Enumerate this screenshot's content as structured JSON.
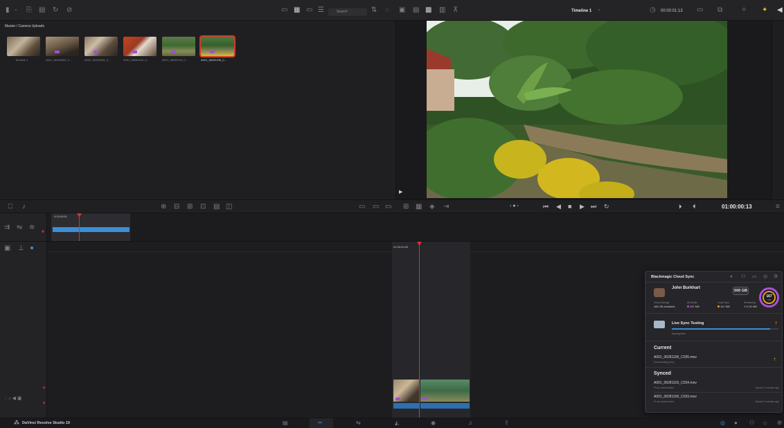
{
  "toolbar": {
    "search_placeholder": "Search",
    "timeline_name": "Timeline 1",
    "timecode": "00:00:01:13"
  },
  "media_pool": {
    "path": "Master / Camera Uploads",
    "clips": [
      {
        "name": "Timeline 1"
      },
      {
        "name": "A001_06100902_C..."
      },
      {
        "name": "A001_06100943_C..."
      },
      {
        "name": "A001_06281100_C..."
      },
      {
        "name": "A001_06281103_C..."
      },
      {
        "name": "A001_06281106_C..."
      }
    ]
  },
  "viewer": {
    "timecode": "01:00:00:13"
  },
  "timeline": {
    "range_start": "01:00:00:00",
    "mini_start": "01:00:00:00"
  },
  "cloud_sync": {
    "title": "Blackmagic Cloud Sync",
    "user": "John Burkhart",
    "plan": "500 GB",
    "ring_value": "167",
    "ring_unit": "MB",
    "stats": [
      {
        "label": "Cloud Storage",
        "value": "486 GB Available"
      },
      {
        "label": "All Media",
        "value": "167 MB"
      },
      {
        "label": "Local Sync",
        "value": "167 MB"
      },
      {
        "label": "Remaining",
        "value": "0.00 MB"
      }
    ],
    "project": {
      "name": "Live Sync Testing",
      "status": "Syncing files",
      "progress": 0.92
    },
    "current_heading": "Current",
    "current_files": [
      {
        "name": "A001_06281106_C035.mov",
        "status": "Downloading proxy"
      }
    ],
    "synced_heading": "Synced",
    "synced_files": [
      {
        "name": "A001_06281103_C034.mov",
        "status": "Proxy downloaded",
        "time": "Synced 2 minutes ago"
      },
      {
        "name": "A001_06281100_C033.mov",
        "status": "Proxy downloaded",
        "time": "Synced 3 minutes ago"
      }
    ],
    "colors": {
      "ring_outer": "#b04fd6",
      "ring_inner": "#e0a21c",
      "progress": "#3b8fd6"
    }
  },
  "app": {
    "name": "DaVinci Resolve Studio 19"
  }
}
